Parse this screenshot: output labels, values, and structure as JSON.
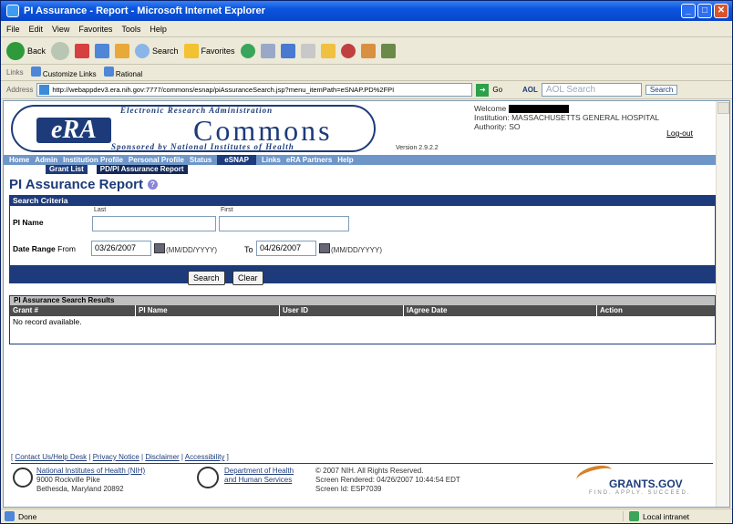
{
  "window": {
    "title": "PI Assurance - Report - Microsoft Internet Explorer"
  },
  "menu": [
    "File",
    "Edit",
    "View",
    "Favorites",
    "Tools",
    "Help"
  ],
  "toolbar": {
    "back": "Back",
    "search": "Search",
    "favorites": "Favorites"
  },
  "links_bar": {
    "label": "Links",
    "items": [
      "Customize Links",
      "Rational"
    ]
  },
  "address": {
    "label": "Address",
    "url": "http://webappdev3.era.nih.gov:7777/commons/esnap/piAssuranceSearch.jsp?menu_itemPath=eSNAP.PD%2FPI",
    "go": "Go",
    "aol": "AOL",
    "aol_search": "AOL Search",
    "search_btn": "Search"
  },
  "header": {
    "logo_top": "Electronic Research Administration",
    "logo_era": "eRA",
    "logo_commons": "Commons",
    "logo_bottom": "Sponsored by National Institutes of Health",
    "version": "Version 2.9.2.2",
    "welcome": "Welcome",
    "institution": "Institution: MASSACHUSETTS GENERAL HOSPITAL",
    "authority": "Authority:  SO",
    "logout": "Log-out"
  },
  "nav": {
    "items": [
      "Home",
      "Admin",
      "Institution Profile",
      "Personal Profile",
      "Status",
      "eSNAP",
      "Links",
      "eRA Partners",
      "Help"
    ],
    "sub": [
      "Grant List",
      "PD/PI Assurance Report"
    ]
  },
  "page": {
    "title": "PI Assurance Report"
  },
  "criteria": {
    "header": "Search Criteria",
    "pi_name_label": "PI Name",
    "last_label": "Last",
    "first_label": "First",
    "date_range_label": "Date Range",
    "from_label": "From",
    "from_value": "03/26/2007",
    "format_hint": "(MM/DD/YYYY)",
    "to_label": "To",
    "to_value": "04/26/2007",
    "search_button": "Search",
    "clear_button": "Clear"
  },
  "results": {
    "header": "PI Assurance Search Results",
    "columns": [
      "Grant #",
      "PI Name",
      "User ID",
      "IAgree Date",
      "Action"
    ],
    "empty": "No record available."
  },
  "footer": {
    "links": [
      "Contact Us/Help Desk",
      "Privacy Notice",
      "Disclaimer",
      "Accessibility"
    ],
    "nih_name": "National Institutes of Health (NIH)",
    "nih_addr1": "9000 Rockville Pike",
    "nih_addr2": "Bethesda, Maryland 20892",
    "hhs1": "Department of Health",
    "hhs2": "and Human Services",
    "copyright": "© 2007 NIH. All Rights Reserved.",
    "rendered": "Screen Rendered: 04/26/2007 10:44:54 EDT",
    "screen_id": "Screen Id: ESP7039",
    "grants": "GRANTS.GOV",
    "grants_tag": "FIND. APPLY. SUCCEED."
  },
  "status": {
    "left": "Done",
    "zone": "Local intranet"
  }
}
